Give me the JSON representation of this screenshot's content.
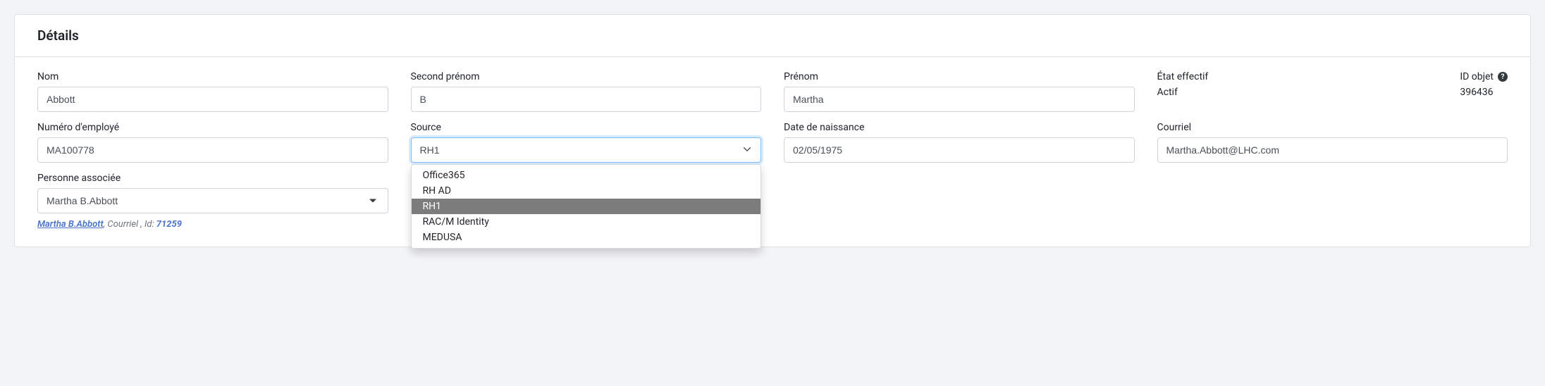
{
  "card": {
    "title": "Détails"
  },
  "fields": {
    "nom": {
      "label": "Nom",
      "value": "Abbott"
    },
    "secondPrenom": {
      "label": "Second prénom",
      "value": "B"
    },
    "prenom": {
      "label": "Prénom",
      "value": "Martha"
    },
    "etatEffectif": {
      "label": "État effectif",
      "value": "Actif"
    },
    "idObjet": {
      "label": "ID objet",
      "value": "396436"
    },
    "numeroEmploye": {
      "label": "Numéro d'employé",
      "value": "MA100778"
    },
    "source": {
      "label": "Source",
      "selected": "RH1",
      "options": [
        "Office365",
        "RH AD",
        "RH1",
        "RAC/M Identity",
        "MEDUSA"
      ]
    },
    "dateNaissance": {
      "label": "Date de naissance",
      "value": "02/05/1975"
    },
    "courriel": {
      "label": "Courriel",
      "value": "Martha.Abbott@LHC.com"
    },
    "personneAssociee": {
      "label": "Personne associée",
      "selected": "Martha B.Abbott",
      "link": {
        "name": "Martha B.Abbott",
        "detail": ", Courriel , Id: ",
        "id": "71259"
      }
    }
  }
}
